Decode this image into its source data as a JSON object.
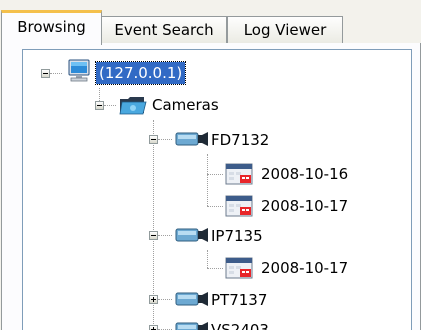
{
  "tabs": [
    {
      "label": "Browsing",
      "active": true
    },
    {
      "label": "Event Search",
      "active": false
    },
    {
      "label": "Log Viewer",
      "active": false
    }
  ],
  "tree": {
    "server": {
      "label": "(127.0.0.1)",
      "icon": "computer-icon",
      "selected": true,
      "expanded": true
    },
    "cameras_folder": {
      "label": "Cameras",
      "icon": "folder-camera-icon",
      "expanded": true
    },
    "cameras": [
      {
        "label": "FD7132",
        "icon": "camera-icon",
        "expanded": true,
        "dates": [
          "2008-10-16",
          "2008-10-17"
        ]
      },
      {
        "label": "IP7135",
        "icon": "camera-icon",
        "expanded": true,
        "dates": [
          "2008-10-17"
        ]
      },
      {
        "label": "PT7137",
        "icon": "camera-icon",
        "expanded": false,
        "dates": []
      },
      {
        "label": "VS2403",
        "icon": "camera-icon",
        "expanded": false,
        "dates": []
      }
    ]
  },
  "colors": {
    "selection": "#316ac5",
    "active_tab_accent": "#f4c04c",
    "tree_border": "#7f9db9"
  }
}
